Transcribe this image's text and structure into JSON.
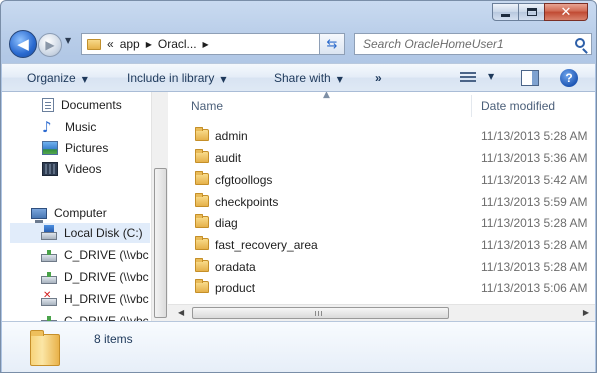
{
  "window": {
    "caption": {
      "minimize_icon": "minimize-icon",
      "maximize_icon": "maximize-icon",
      "close_icon": "close-icon"
    }
  },
  "navbar": {
    "breadcrumb": [
      "«",
      "app",
      "Oracl..."
    ],
    "search_placeholder": "Search OracleHomeUser1"
  },
  "toolbar": {
    "organize": "Organize",
    "include_in_library": "Include in library",
    "share_with": "Share with",
    "more": "»"
  },
  "sidebar": {
    "items": [
      {
        "label": "Documents",
        "icon": "documents-icon"
      },
      {
        "label": "Music",
        "icon": "music-icon"
      },
      {
        "label": "Pictures",
        "icon": "pictures-icon"
      },
      {
        "label": "Videos",
        "icon": "videos-icon"
      },
      {
        "label": "Computer",
        "icon": "computer-icon"
      },
      {
        "label": "Local Disk (C:)",
        "icon": "local-disk-icon",
        "selected": true
      },
      {
        "label": "C_DRIVE (\\\\vbc",
        "icon": "network-drive-icon"
      },
      {
        "label": "D_DRIVE (\\\\vbc",
        "icon": "network-drive-icon"
      },
      {
        "label": "H_DRIVE (\\\\vbc",
        "icon": "network-drive-disconnected-icon"
      },
      {
        "label": "C_DRIVE (\\\\vbc",
        "icon": "network-drive-icon"
      }
    ]
  },
  "file_list": {
    "columns": {
      "name": "Name",
      "date_modified": "Date modified"
    },
    "rows": [
      {
        "name": "admin",
        "date": "11/13/2013 5:28 AM"
      },
      {
        "name": "audit",
        "date": "11/13/2013 5:36 AM"
      },
      {
        "name": "cfgtoollogs",
        "date": "11/13/2013 5:42 AM"
      },
      {
        "name": "checkpoints",
        "date": "11/13/2013 5:59 AM"
      },
      {
        "name": "diag",
        "date": "11/13/2013 5:28 AM"
      },
      {
        "name": "fast_recovery_area",
        "date": "11/13/2013 5:28 AM"
      },
      {
        "name": "oradata",
        "date": "11/13/2013 5:28 AM"
      },
      {
        "name": "product",
        "date": "11/13/2013 5:06 AM"
      }
    ]
  },
  "details": {
    "item_count": "8 items"
  }
}
